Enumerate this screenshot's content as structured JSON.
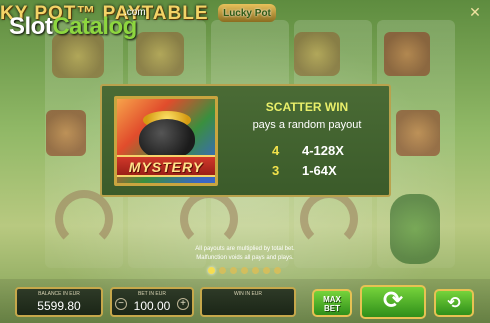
{
  "header": {
    "title": "KY POT™ PAYTABLE",
    "watermark_main": "Slot",
    "watermark_accent": "Catalog",
    "watermark_suffix": ".com",
    "game_logo": "Lucky Pot",
    "close_icon": "close-icon"
  },
  "popup": {
    "symbol_name": "MYSTERY",
    "heading": "SCATTER WIN",
    "description": "pays a random payout",
    "payouts": [
      {
        "count": "4",
        "value": "4-128X"
      },
      {
        "count": "3",
        "value": "1-64X"
      }
    ]
  },
  "footnote": {
    "line1": "All payouts are multiplied by total bet.",
    "line2": "Malfunction voids all pays and plays."
  },
  "pagination": {
    "total": 7,
    "current": 1
  },
  "bottom_bar": {
    "balance_label": "BALANCE IN EUR",
    "balance_value": "5599.80",
    "bet_label": "BET IN EUR",
    "bet_value": "100.00",
    "bet_minus": "−",
    "bet_plus": "+",
    "win_label": "WIN IN EUR",
    "win_value": "",
    "maxbet_line1": "MAX",
    "maxbet_line2": "BET",
    "spin_icon": "spin-icon",
    "autoplay_icon": "autoplay-icon"
  },
  "colors": {
    "accent_gold": "#c6a84b",
    "button_green": "#2f8f1a",
    "heading_yellow": "#e9ef6a",
    "count_yellow": "#f2e24c",
    "popup_bg": "#3b5b2a"
  }
}
